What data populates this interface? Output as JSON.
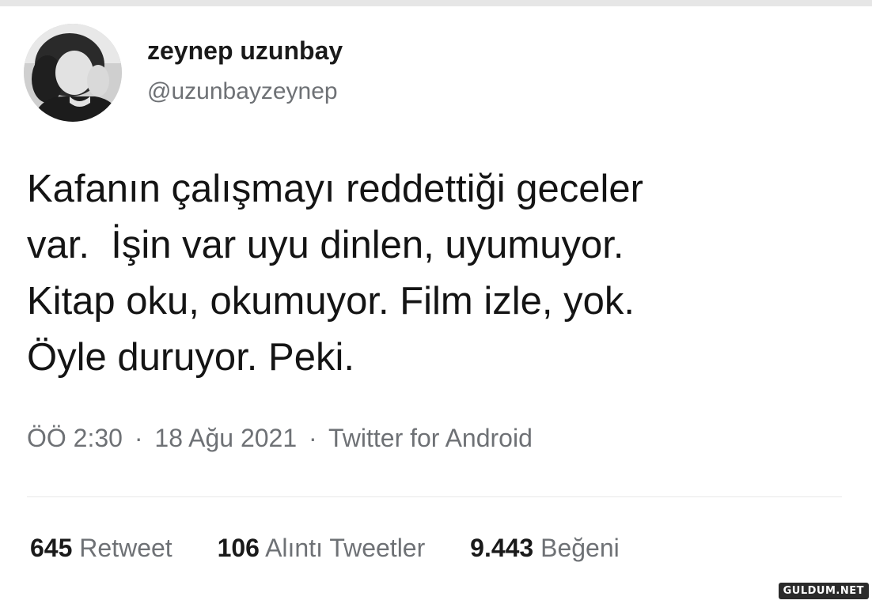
{
  "author": {
    "display_name": "zeynep uzunbay",
    "handle": "@uzunbayzeynep",
    "avatar_icon": "user-avatar-photo"
  },
  "tweet": {
    "lines": [
      "Kafanın çalışmayı reddettiği geceler",
      "var.  İşin var uyu dinlen, uyumuyor.",
      "Kitap oku, okumuyor. Film izle, yok.",
      "Öyle duruyor. Peki."
    ]
  },
  "meta": {
    "time": "ÖÖ 2:30",
    "separator": "·",
    "date": "18 Ağu 2021",
    "source": "Twitter for Android"
  },
  "stats": {
    "retweets": {
      "count": "645",
      "label": "Retweet"
    },
    "quotes": {
      "count": "106",
      "label": "Alıntı Tweetler"
    },
    "likes": {
      "count": "9.443",
      "label": "Beğeni"
    }
  },
  "watermark": {
    "text": "GULDUM.NET"
  },
  "colors": {
    "text_primary": "#141414",
    "text_secondary": "#6e7175",
    "divider": "#e7e7e7",
    "background": "#ffffff"
  }
}
